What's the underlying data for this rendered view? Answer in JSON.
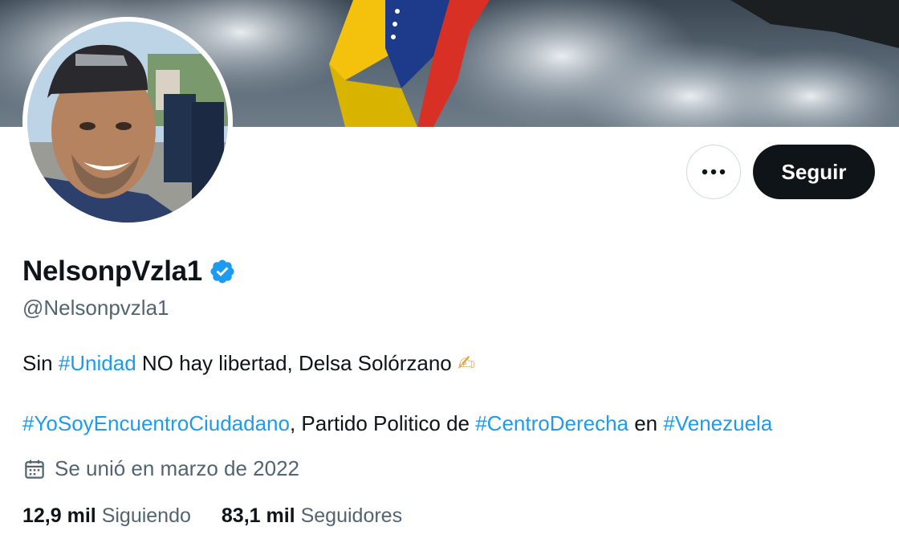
{
  "profile": {
    "display_name": "NelsonpVzla1",
    "handle": "@Nelsonpvzla1",
    "verified_icon": "verified-badge-icon",
    "bio": {
      "line1_before": "Sin ",
      "line1_hashtag": "#Unidad",
      "line1_after": " NO hay libertad, Delsa Solórzano ",
      "line1_emoji": "✍",
      "line2_hashtag1": "#YoSoyEncuentroCiudadano",
      "line2_text1": ", Partido Politico de ",
      "line2_hashtag2": "#CentroDerecha",
      "line2_text2": " en ",
      "line2_hashtag3": "#Venezuela"
    },
    "joined": "Se unió en marzo de 2022",
    "following_count": "12,9 mil",
    "following_label": "Siguiendo",
    "followers_count": "83,1 mil",
    "followers_label": "Seguidores"
  },
  "actions": {
    "follow_label": "Seguir",
    "more_icon": "more-options-icon"
  },
  "colors": {
    "accent": "#1d9bf0",
    "text": "#0f1419",
    "secondary_text": "#536471",
    "follow_bg": "#0f1419"
  }
}
